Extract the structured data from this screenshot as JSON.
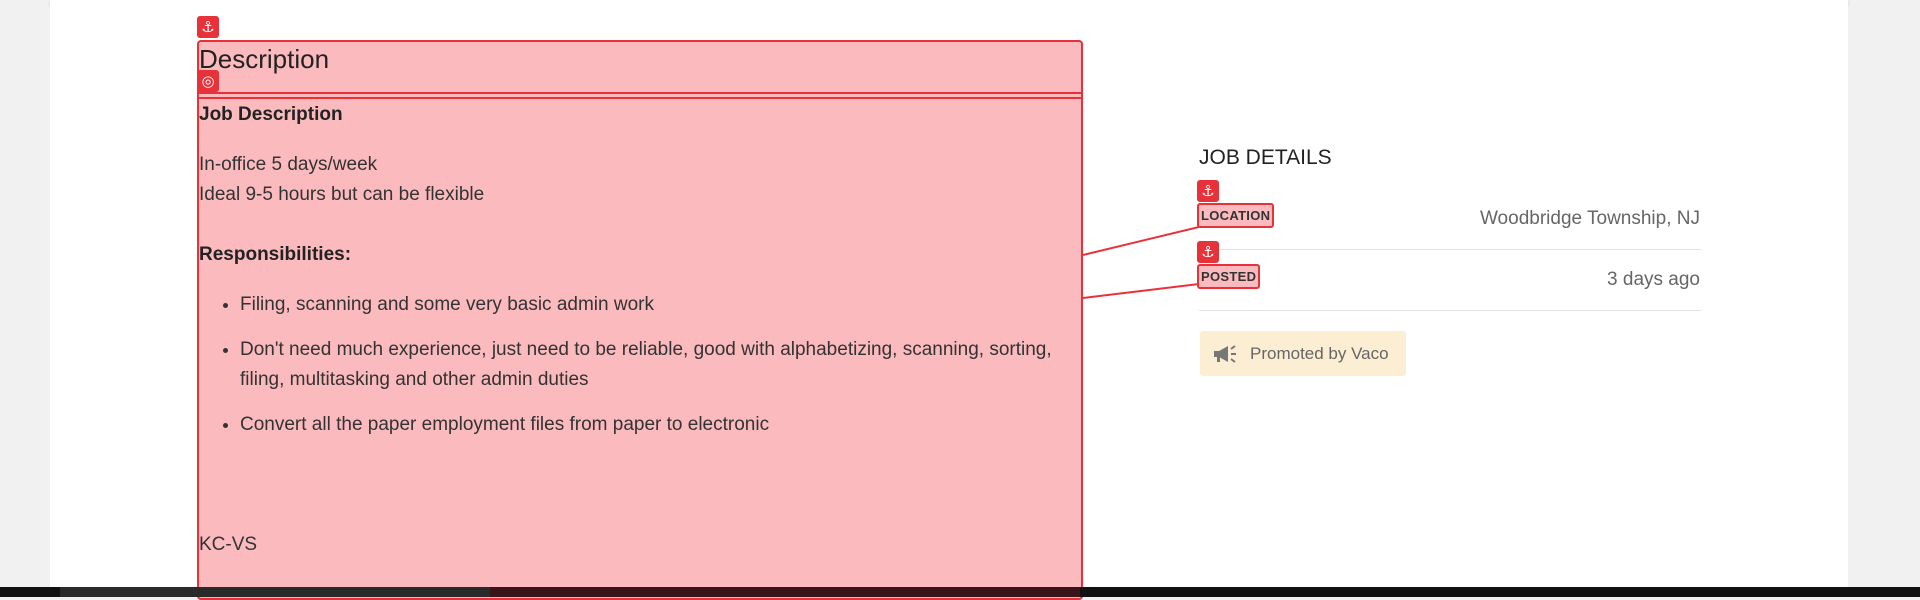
{
  "description": {
    "heading": "Description",
    "job_description_heading": "Job Description",
    "lines": [
      "In-office 5 days/week",
      "Ideal 9-5 hours but can be flexible"
    ],
    "responsibilities_heading": "Responsibilities:",
    "responsibilities": [
      "Filing, scanning and some very basic admin work",
      "Don't need much experience, just need to be reliable, good with alphabetizing, scanning, sorting, filing, multitasking and other admin duties",
      "Convert all the paper employment files from paper to electronic"
    ],
    "code": "KC-VS"
  },
  "job_details": {
    "title": "JOB DETAILS",
    "location_label": "LOCATION",
    "location_value": "Woodbridge Township, NJ",
    "posted_label": "POSTED",
    "posted_value": "3 days ago",
    "promoted_text": "Promoted by Vaco"
  },
  "icons": {
    "anchor": "anchor-icon",
    "target": "target-icon",
    "megaphone": "megaphone-icon"
  },
  "colors": {
    "overlay_border": "#e8323a",
    "overlay_fill": "#f45f69",
    "promo_bg": "#fbeed3"
  }
}
